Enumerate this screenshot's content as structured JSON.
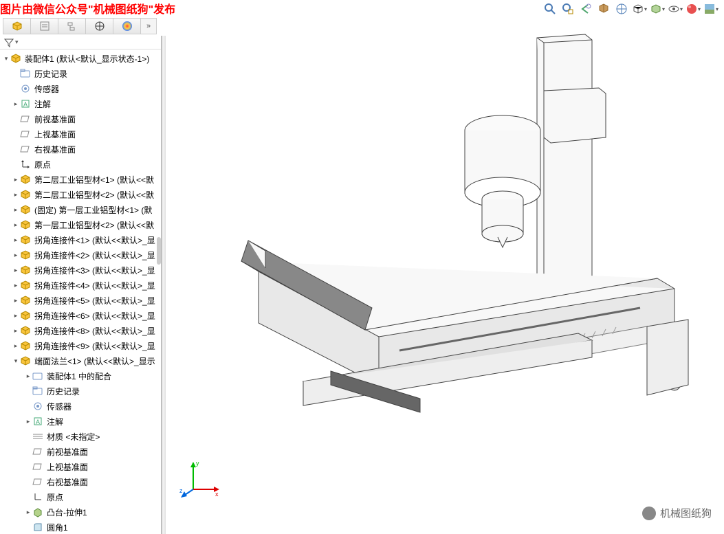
{
  "banner": "图片由微信公众号\"机械图纸狗\"发布",
  "watermark": "机械图纸狗",
  "rootNode": "装配体1 (默认<默认_显示状态-1>)",
  "treeTop": {
    "history": "历史记录",
    "sensors": "传感器",
    "annotations": "注解",
    "frontPlane": "前视基准面",
    "topPlane": "上视基准面",
    "rightPlane": "右视基准面",
    "origin": "原点"
  },
  "parts": [
    "第二层工业铝型材<1> (默认<<默",
    "第二层工业铝型材<2> (默认<<默",
    "(固定) 第一层工业铝型材<1> (默",
    "第一层工业铝型材<2> (默认<<默",
    "拐角连接件<1> (默认<<默认>_显",
    "拐角连接件<2> (默认<<默认>_显",
    "拐角连接件<3> (默认<<默认>_显",
    "拐角连接件<4> (默认<<默认>_显",
    "拐角连接件<5> (默认<<默认>_显",
    "拐角连接件<6> (默认<<默认>_显",
    "拐角连接件<8> (默认<<默认>_显",
    "拐角连接件<9> (默认<<默认>_显"
  ],
  "expandedPart": "端面法兰<1> (默认<<默认>_显示",
  "subTree": {
    "mates": "装配体1 中的配合",
    "history": "历史记录",
    "sensors": "传感器",
    "annotations": "注解",
    "material": "材质 <未指定>",
    "frontPlane": "前视基准面",
    "topPlane": "上视基准面",
    "rightPlane": "右视基准面",
    "origin": "原点",
    "extrude": "凸台-拉伸1",
    "fillet": "圆角1"
  },
  "triad": {
    "x": "x",
    "y": "y",
    "z": "z"
  }
}
